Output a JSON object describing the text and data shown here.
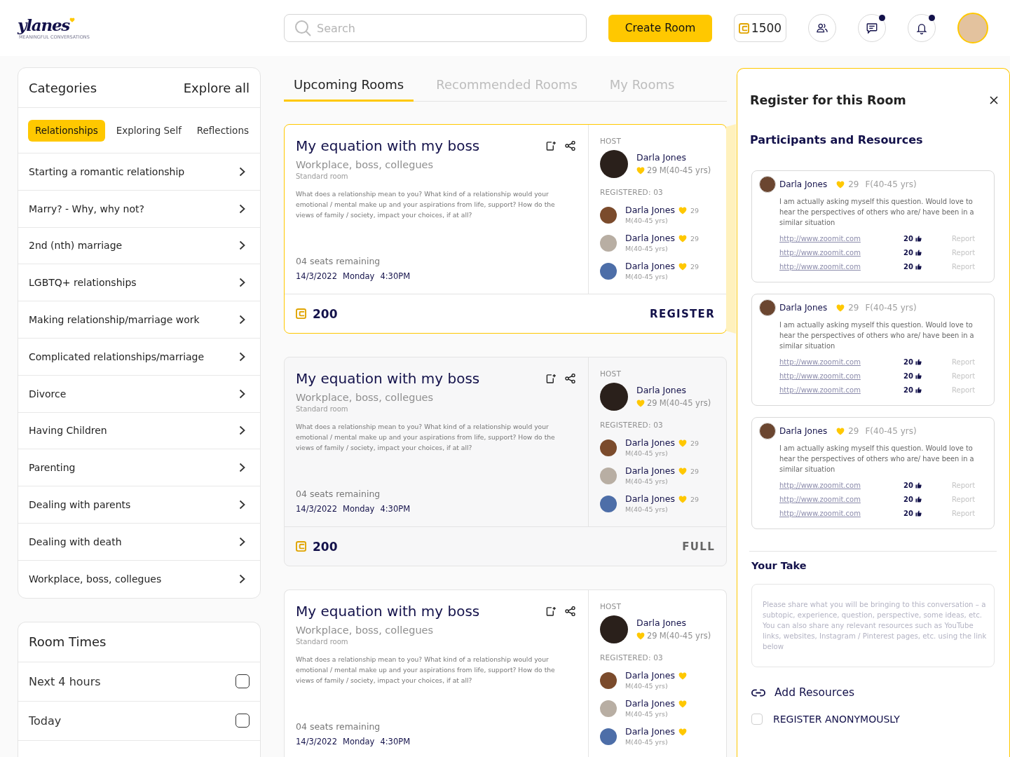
{
  "header": {
    "logo": "ylanes",
    "logo_tagline": "MEANINGFUL CONVERSATIONS",
    "search": {
      "placeholder": "Search"
    },
    "create_button": "Create Room",
    "coins": "1500",
    "icon_buttons": [
      {
        "kind": "people",
        "unread": false
      },
      {
        "kind": "chat",
        "unread": true
      },
      {
        "kind": "bell",
        "unread": true
      }
    ]
  },
  "categories": {
    "title": "Categories",
    "explore_link": "Explore all",
    "chips": [
      {
        "label": "Relationships",
        "selected": true
      },
      {
        "label": "Exploring Self",
        "selected": false
      },
      {
        "label": "Reflections",
        "selected": false
      }
    ],
    "items": [
      "Starting a romantic relationship",
      "Marry? - Why, why not?",
      "2nd (nth) marriage",
      "LGBTQ+ relationships",
      "Making relationship/marriage work",
      "Complicated relationships/marriage",
      "Divorce",
      "Having Children",
      "Parenting",
      "Dealing with parents",
      "Dealing with death",
      "Workplace, boss, collegues"
    ]
  },
  "room_times": {
    "title": "Room Times",
    "options": [
      {
        "label": "Next 4 hours",
        "checked": false
      },
      {
        "label": "Today",
        "checked": false
      }
    ]
  },
  "tabs": [
    {
      "label": "Upcoming Rooms",
      "selected": true
    },
    {
      "label": "Recommended Rooms",
      "selected": false
    },
    {
      "label": "My Rooms",
      "selected": false
    }
  ],
  "rooms": [
    {
      "selected": true,
      "title": "My equation with my boss",
      "category": "Workplace, boss, collegues",
      "room_type": "Standard room",
      "description": "What does a relationship mean to you? What kind of a relationship would your emotional / mental make up and your aspirations from life, support? How do the views of family / society, impact your choices, if at all?",
      "seats": "04 seats remaining",
      "date": "14/3/2022",
      "day": "Monday",
      "time": "4:30PM",
      "host_label": "HOST",
      "host": {
        "name": "Darla Jones",
        "hearts": "29",
        "gender_age": "M(40-45 yrs)"
      },
      "registered_label": "REGISTERED: 03",
      "attendees": [
        {
          "name": "Darla Jones",
          "hearts": "29",
          "gender_age": "M(40-45 yrs)"
        },
        {
          "name": "Darla Jones",
          "hearts": "29",
          "gender_age": "M(40-45 yrs)"
        },
        {
          "name": "Darla Jones",
          "hearts": "29",
          "gender_age": "M(40-45 yrs)"
        }
      ],
      "price": "200",
      "action": {
        "kind": "register",
        "label": "REGISTER"
      }
    },
    {
      "selected": false,
      "title": "My equation with my boss",
      "category": "Workplace, boss, collegues",
      "room_type": "Standard room",
      "description": "What does a relationship mean to you? What kind of a relationship would your emotional / mental make up and your aspirations from life, support? How do the views of family / society, impact your choices, if at all?",
      "seats": "04 seats remaining",
      "date": "14/3/2022",
      "day": "Monday",
      "time": "4:30PM",
      "host_label": "HOST",
      "host": {
        "name": "Darla Jones",
        "hearts": "29",
        "gender_age": "M(40-45 yrs)"
      },
      "registered_label": "REGISTERED: 03",
      "attendees": [
        {
          "name": "Darla Jones",
          "hearts": "29",
          "gender_age": "M(40-45 yrs)"
        },
        {
          "name": "Darla Jones",
          "hearts": "29",
          "gender_age": "M(40-45 yrs)"
        },
        {
          "name": "Darla Jones",
          "hearts": "29",
          "gender_age": "M(40-45 yrs)"
        }
      ],
      "price": "200",
      "action": {
        "kind": "full",
        "label": "FULL"
      }
    },
    {
      "selected": false,
      "title": "My equation with my boss",
      "category": "Workplace, boss, collegues",
      "room_type": "Standard room",
      "description": "What does a relationship mean to you? What kind of a relationship would your emotional / mental make up and your aspirations from life, support? How do the views of family / society, impact your choices, if at all?",
      "seats": "04 seats remaining",
      "date": "14/3/2022",
      "day": "Monday",
      "time": "4:30PM",
      "host_label": "HOST",
      "host": {
        "name": "Darla Jones",
        "hearts": "29",
        "gender_age": "M(40-45 yrs)"
      },
      "registered_label": "REGISTERED: 03",
      "attendees": [
        {
          "name": "Darla Jones",
          "gender_age": "M(40-45 yrs)"
        },
        {
          "name": "Darla Jones",
          "gender_age": "M(40-45 yrs)"
        },
        {
          "name": "Darla Jones",
          "gender_age": "M(40-45 yrs)"
        }
      ]
    }
  ],
  "register_panel": {
    "title": "Register for this Room",
    "section_title": "Participants and Resources",
    "participants": [
      {
        "name": "Darla Jones",
        "hearts": "29",
        "gender_age": "F(40-45 yrs)",
        "comment": "I am actually asking myself this question. Would love to hear the perspectives of others who are/ have been in a similar situation",
        "resources": [
          {
            "url": "http://www.zoomit.com",
            "likes": "20",
            "report": "Report"
          },
          {
            "url": "http://www.zoomit.com",
            "likes": "20",
            "report": "Report"
          },
          {
            "url": "http://www.zoomit.com",
            "likes": "20",
            "report": "Report"
          }
        ]
      },
      {
        "name": "Darla Jones",
        "hearts": "29",
        "gender_age": "F(40-45 yrs)",
        "comment": "I am actually asking myself this question. Would love to hear the perspectives of others who are/ have been in a similar situation",
        "resources": [
          {
            "url": "http://www.zoomit.com",
            "likes": "20",
            "report": "Report"
          },
          {
            "url": "http://www.zoomit.com",
            "likes": "20",
            "report": "Report"
          },
          {
            "url": "http://www.zoomit.com",
            "likes": "20",
            "report": "Report"
          }
        ]
      },
      {
        "name": "Darla Jones",
        "hearts": "29",
        "gender_age": "F(40-45 yrs)",
        "comment": "I am actually asking myself this question. Would love to hear the perspectives of others who are/ have been in a similar situation",
        "resources": [
          {
            "url": "http://www.zoomit.com",
            "likes": "20",
            "report": "Report"
          },
          {
            "url": "http://www.zoomit.com",
            "likes": "20",
            "report": "Report"
          },
          {
            "url": "http://www.zoomit.com",
            "likes": "20",
            "report": "Report"
          }
        ]
      }
    ],
    "your_take": {
      "title": "Your Take",
      "placeholder": "Please share what you will be bringing to this conversation – a subtopic, experience, question, perspective, some ideas, etc. You can also share any relevant resources such as YouTube links, websites, Instagram / Pinterest pages, etc. using the link below"
    },
    "add_resources": "Add Resources",
    "anonymous": {
      "label": "REGISTER ANONYMOUSLY",
      "checked": false
    }
  }
}
